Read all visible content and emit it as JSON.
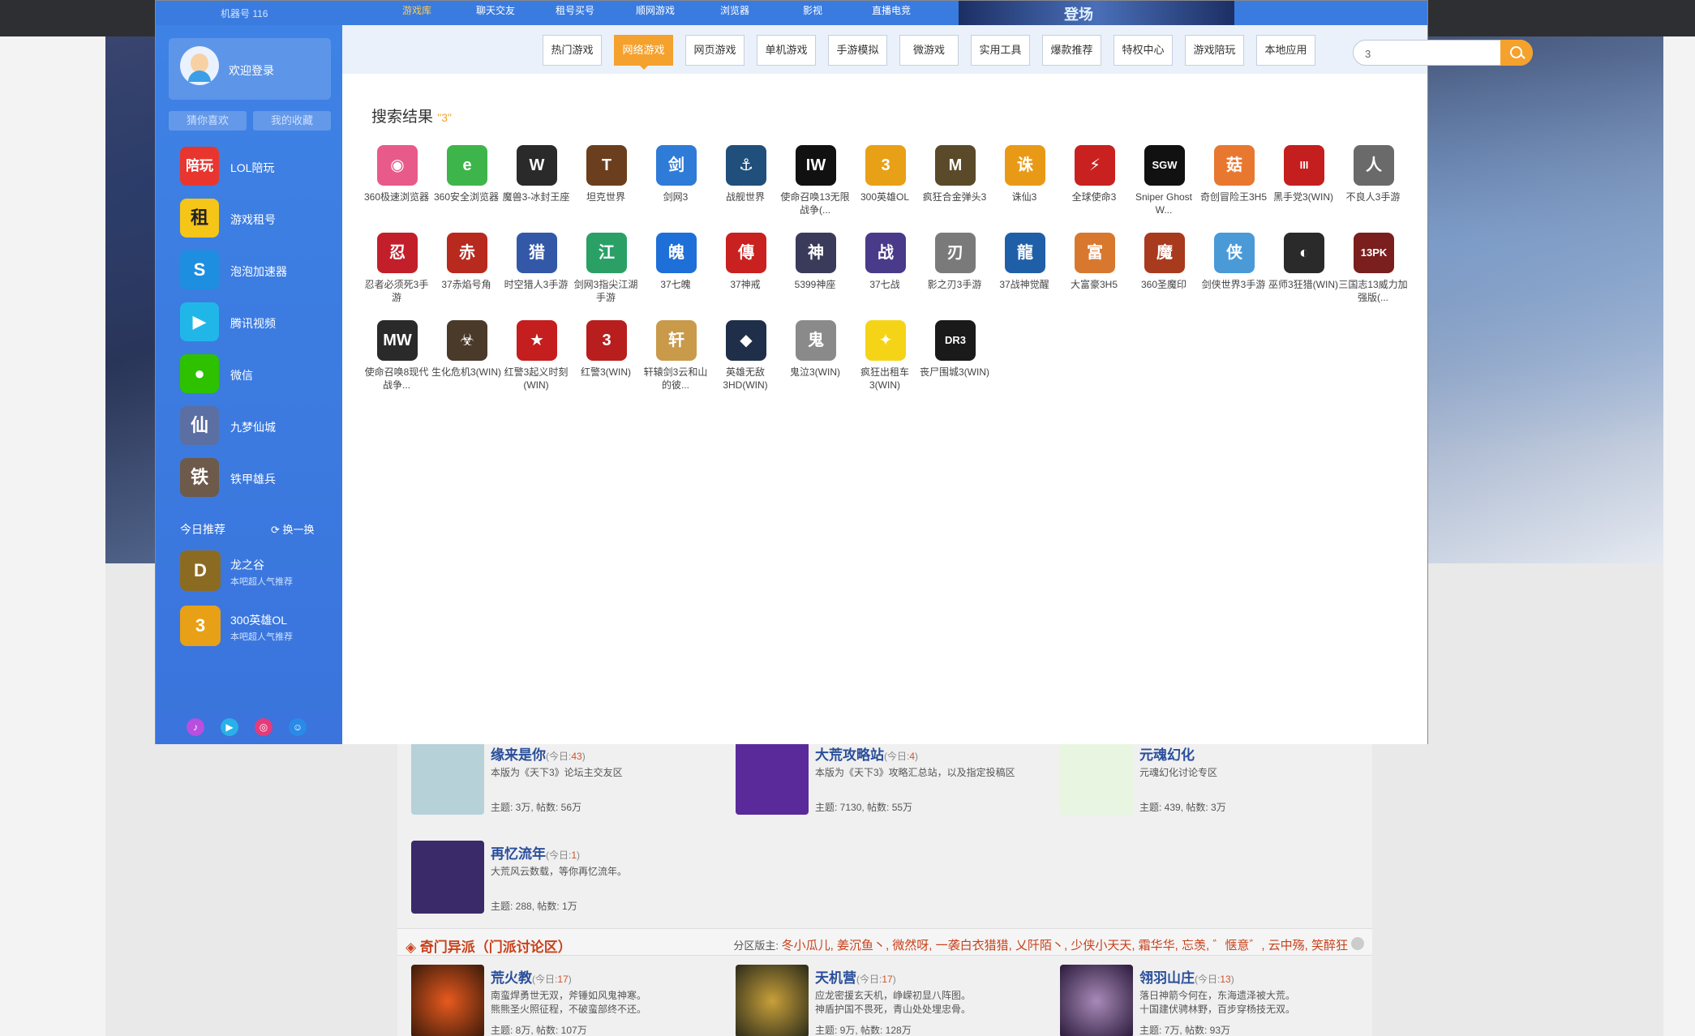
{
  "topnav": {
    "machine": "机器号 116",
    "tabs": [
      "游戏库",
      "聊天交友",
      "租号买号",
      "顺网游戏",
      "浏览器",
      "影视",
      "直播电竞"
    ],
    "banner_text": "登场"
  },
  "sidebar": {
    "login": "欢迎登录",
    "tabs": [
      "猜你喜欢",
      "我的收藏"
    ],
    "items": [
      {
        "label": "LOL陪玩",
        "icon": "陪玩",
        "color": "#e8362f"
      },
      {
        "label": "游戏租号",
        "icon": "租",
        "color": "#f5c518"
      },
      {
        "label": "泡泡加速器",
        "icon": "S",
        "color": "#1e8fe0"
      },
      {
        "label": "腾讯视频",
        "icon": "▶",
        "color": "#21b6e8"
      },
      {
        "label": "微信",
        "icon": "●",
        "color": "#2dc100"
      },
      {
        "label": "九梦仙城",
        "icon": "仙",
        "color": "#5b6fa3"
      },
      {
        "label": "铁甲雄兵",
        "icon": "铁",
        "color": "#6d5a4a"
      }
    ],
    "today": "今日推荐",
    "refresh": "换一换",
    "recommend": [
      {
        "name": "龙之谷",
        "desc": "本吧超人气推荐",
        "icon": "D",
        "color": "#8b6b22"
      },
      {
        "name": "300英雄OL",
        "desc": "本吧超人气推荐",
        "icon": "3",
        "color": "#e8a017"
      }
    ],
    "footer_icons": [
      "music-icon",
      "play-icon",
      "gamepad-icon",
      "qq-icon"
    ]
  },
  "categories": [
    "热门游戏",
    "网络游戏",
    "网页游戏",
    "单机游戏",
    "手游模拟",
    "微游戏",
    "实用工具",
    "爆款推荐",
    "特权中心",
    "游戏陪玩",
    "本地应用"
  ],
  "search": {
    "value": "3"
  },
  "results": {
    "title": "搜索结果",
    "query": "\"3\"",
    "games": [
      {
        "name": "360极速浏览器",
        "icon": "◉",
        "color": "#e85a8a"
      },
      {
        "name": "360安全浏览器",
        "icon": "e",
        "color": "#3eb54a"
      },
      {
        "name": "魔兽3-冰封王座",
        "icon": "W",
        "color": "#2a2a2a"
      },
      {
        "name": "坦克世界",
        "icon": "T",
        "color": "#6b3f1e"
      },
      {
        "name": "剑网3",
        "icon": "剑",
        "color": "#2f7bd8"
      },
      {
        "name": "战舰世界",
        "icon": "⚓",
        "color": "#1f4f7a"
      },
      {
        "name": "使命召唤13无限战争(...",
        "icon": "IW",
        "color": "#111111"
      },
      {
        "name": "300英雄OL",
        "icon": "3",
        "color": "#e8a017"
      },
      {
        "name": "疯狂合金弹头3",
        "icon": "M",
        "color": "#5a4a2a"
      },
      {
        "name": "诛仙3",
        "icon": "诛",
        "color": "#e89a17"
      },
      {
        "name": "全球使命3",
        "icon": "⚡",
        "color": "#c8211f"
      },
      {
        "name": "Sniper Ghost W...",
        "icon": "SGW",
        "color": "#111111"
      },
      {
        "name": "奇创冒险王3H5",
        "icon": "菇",
        "color": "#e8782f"
      },
      {
        "name": "黑手党3(WIN)",
        "icon": "III",
        "color": "#c41e1e"
      },
      {
        "name": "不良人3手游",
        "icon": "人",
        "color": "#6a6a6a"
      },
      {
        "name": "忍者必须死3手游",
        "icon": "忍",
        "color": "#c21f2a"
      },
      {
        "name": "37赤焰号角",
        "icon": "赤",
        "color": "#b8291e"
      },
      {
        "name": "时空猎人3手游",
        "icon": "猎",
        "color": "#3358a8"
      },
      {
        "name": "剑网3指尖江湖手游",
        "icon": "江",
        "color": "#2aa066"
      },
      {
        "name": "37七魄",
        "icon": "魄",
        "color": "#1e6fd8"
      },
      {
        "name": "37神戒",
        "icon": "傳",
        "color": "#c8211f"
      },
      {
        "name": "5399神座",
        "icon": "神",
        "color": "#3a3a5a"
      },
      {
        "name": "37七战",
        "icon": "战",
        "color": "#4a3a8a"
      },
      {
        "name": "影之刃3手游",
        "icon": "刃",
        "color": "#7a7a7a"
      },
      {
        "name": "37战神觉醒",
        "icon": "龍",
        "color": "#1f5fa8"
      },
      {
        "name": "大富豪3H5",
        "icon": "富",
        "color": "#d8782f"
      },
      {
        "name": "360圣魔印",
        "icon": "魔",
        "color": "#a83a1e"
      },
      {
        "name": "剑侠世界3手游",
        "icon": "侠",
        "color": "#4a9ad8"
      },
      {
        "name": "巫师3狂猎(WIN)",
        "icon": "◐",
        "color": "#2a2a2a"
      },
      {
        "name": "三国志13威力加强版(...",
        "icon": "13PK",
        "color": "#7a1e1e"
      },
      {
        "name": "使命召唤8现代战争...",
        "icon": "MW",
        "color": "#2a2a2a"
      },
      {
        "name": "生化危机3(WIN)",
        "icon": "☣",
        "color": "#4a3a2a"
      },
      {
        "name": "红警3起义时刻(WIN)",
        "icon": "★",
        "color": "#c41e1e"
      },
      {
        "name": "红警3(WIN)",
        "icon": "3",
        "color": "#b81e1e"
      },
      {
        "name": "轩辕剑3云和山的彼...",
        "icon": "轩",
        "color": "#c89a4a"
      },
      {
        "name": "英雄无敌3HD(WIN)",
        "icon": "◆",
        "color": "#1f2f4a"
      },
      {
        "name": "鬼泣3(WIN)",
        "icon": "鬼",
        "color": "#8a8a8a"
      },
      {
        "name": "疯狂出租车3(WIN)",
        "icon": "✦",
        "color": "#f5d418"
      },
      {
        "name": "丧尸围城3(WIN)",
        "icon": "DR3",
        "color": "#1a1a1a"
      }
    ]
  },
  "forum": {
    "top_sections": [
      {
        "name": "缘来是你",
        "today": "43",
        "desc": "本版为《天下3》论坛主交友区",
        "stats": "主题: 3万, 帖数: 56万",
        "color": "#b7d1d8"
      },
      {
        "name": "大荒攻略站",
        "today": "4",
        "desc": "本版为《天下3》攻略汇总站，以及指定投稿区",
        "stats": "主题: 7130, 帖数: 55万",
        "color": "#5a2a9a"
      },
      {
        "name": "元魂幻化",
        "today": "",
        "desc": "元魂幻化讨论专区",
        "stats": "主题: 439, 帖数: 3万",
        "color": "#7ac850"
      },
      {
        "name": "再忆流年",
        "today": "1",
        "desc": "大荒风云数载，等你再忆流年。",
        "stats": "主题: 288, 帖数: 1万",
        "color": "#3a2a6a"
      }
    ],
    "category_title": "奇门异派（门派讨论区）",
    "moderators_label": "分区版主:",
    "moderators": "冬小瓜儿, 姜沉鱼丶, 微然呀, 一袭白衣猎猎, 乂阡陌丶, 少侠小天天, 霜华华, 忘羡, ゛惬意゛, 云中殇, 笑醉狂",
    "bottom_sections": [
      {
        "name": "荒火教",
        "today": "17",
        "desc": "南蛮焊勇世无双，斧锤如风鬼神寒。熊熊圣火照征程，不破蛮部终不还。",
        "stats": "主题: 8万, 帖数: 107万",
        "color": "#b8291e"
      },
      {
        "name": "天机营",
        "today": "17",
        "desc": "应龙密援玄天机，峥嵘初显八阵图。神盾护国不畏死，青山处处埋忠骨。",
        "stats": "主题: 9万, 帖数: 128万",
        "color": "#4a4a3a"
      },
      {
        "name": "翎羽山庄",
        "today": "13",
        "desc": "落日神箭今何在，东海遗泽被大荒。十国建伏骋林野，百步穿杨技无双。",
        "stats": "主题: 7万, 帖数: 93万",
        "color": "#6a4a7a"
      }
    ]
  }
}
